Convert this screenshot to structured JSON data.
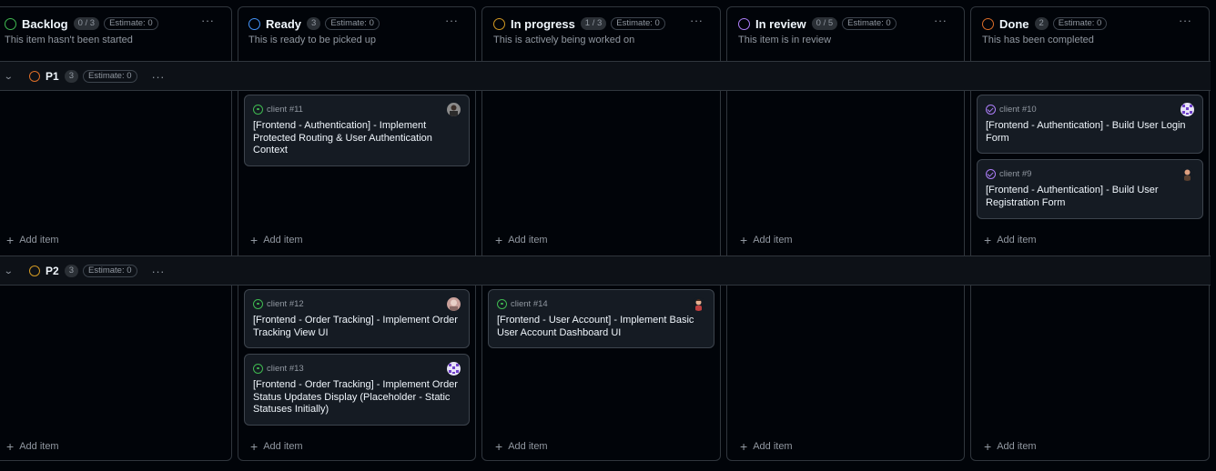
{
  "columns": [
    {
      "title": "Backlog",
      "count": "0 / 3",
      "estimate": "Estimate: 0",
      "description": "This item hasn't been started",
      "color": "#3fb950"
    },
    {
      "title": "Ready",
      "count": "3",
      "estimate": "Estimate: 0",
      "description": "This is ready to be picked up",
      "color": "#4493f8"
    },
    {
      "title": "In progress",
      "count": "1 / 3",
      "estimate": "Estimate: 0",
      "description": "This is actively being worked on",
      "color": "#d29922"
    },
    {
      "title": "In review",
      "count": "0 / 5",
      "estimate": "Estimate: 0",
      "description": "This item is in review",
      "color": "#ab7df8"
    },
    {
      "title": "Done",
      "count": "2",
      "estimate": "Estimate: 0",
      "description": "This has been completed",
      "color": "#db6d28"
    }
  ],
  "groups": [
    {
      "title": "P1",
      "count": "3",
      "estimate": "Estimate: 0",
      "color": "#db6d28"
    },
    {
      "title": "P2",
      "count": "3",
      "estimate": "Estimate: 0",
      "color": "#d29922"
    }
  ],
  "cards": [
    {
      "ref": "client #11",
      "title": "[Frontend - Authentication] - Implement Protected Routing & User Authentication Context",
      "state": "open"
    },
    {
      "ref": "client #10",
      "title": "[Frontend - Authentication] - Build User Login Form",
      "state": "closed"
    },
    {
      "ref": "client #9",
      "title": "[Frontend - Authentication] - Build User Registration Form",
      "state": "closed"
    },
    {
      "ref": "client #12",
      "title": "[Frontend - Order Tracking] - Implement Order Tracking View UI",
      "state": "open"
    },
    {
      "ref": "client #13",
      "title": "[Frontend - Order Tracking] - Implement Order Status Updates Display (Placeholder - Static Statuses Initially)",
      "state": "open"
    },
    {
      "ref": "client #14",
      "title": "[Frontend - User Account] - Implement Basic User Account Dashboard UI",
      "state": "open"
    }
  ],
  "add_item_label": "Add item",
  "colors": {
    "open": "#3fb950",
    "closed": "#ab7df8",
    "background": "#010409"
  }
}
